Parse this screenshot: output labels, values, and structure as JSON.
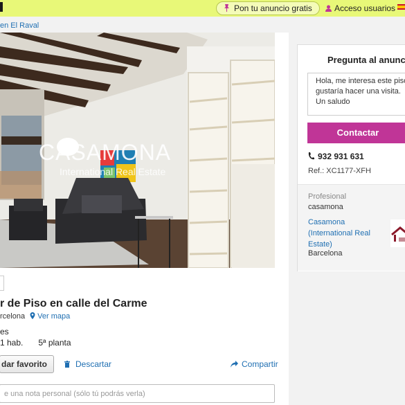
{
  "header": {
    "publish_label": "Pon tu anuncio gratis",
    "access_label": "Acceso usuarios"
  },
  "breadcrumb": "en El Raval",
  "photo": {
    "watermark_brand": "CASAMONA",
    "watermark_sub": "International Real Estate"
  },
  "listing": {
    "title": "r de Piso en calle del Carme",
    "location": "rcelona",
    "map_link": "Ver mapa",
    "features_line1": "es",
    "rooms": "1 hab.",
    "floor": "5ª planta",
    "favorite_label": "dar favorito",
    "discard_label": "Descartar",
    "share_label": "Compartir",
    "note_placeholder": "e una nota personal (sólo tú podrás verla)"
  },
  "contact": {
    "title": "Pregunta al anunc",
    "message": "Hola, me interesa este piso y\ngustaría hacer una visita.\nUn saludo",
    "button_label": "Contactar",
    "phone": "932 931 631",
    "reference": "Ref.: XC1177-XFH",
    "professional_label": "Profesional",
    "professional_name": "casamona",
    "agency_name": "Casamona (International Real Estate)",
    "city": "Barcelona"
  },
  "colors": {
    "topbar": "#e8f878",
    "accent": "#c03597",
    "link": "#1f6fb2"
  },
  "icons": [
    "pin-icon",
    "user-icon",
    "flag-icon",
    "map-pin-icon",
    "trash-icon",
    "share-arrow-icon",
    "phone-icon"
  ]
}
